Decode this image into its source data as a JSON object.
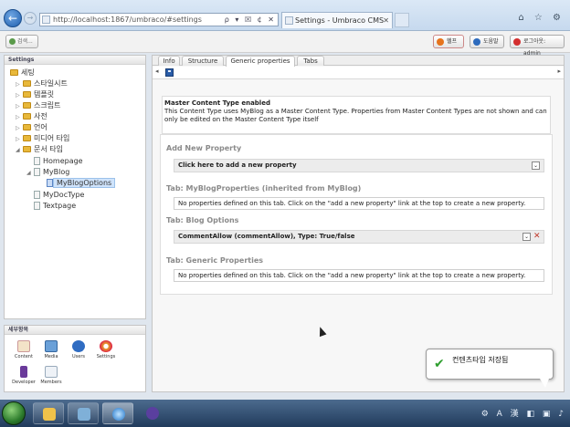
{
  "browser": {
    "url": "http://localhost:1867/umbraco/#settings",
    "address_tools": "ρ ▾ ☒ ¢ ✕",
    "tab_title": "Settings - Umbraco CMS -...",
    "tab_close": "✕",
    "window_tools": "⌂ ☆ ⚙",
    "back_glyph": "←",
    "forward_glyph": "→"
  },
  "topbar": {
    "search_label": "검색...",
    "help_label": "헬프",
    "manual_label": "도움말",
    "logout_label": "로그아웃: admin"
  },
  "left_panel": {
    "title": "Settings",
    "tree": {
      "root": "세팅",
      "stylesheets": "스타일시트",
      "templates": "템플릿",
      "scripts": "스크립트",
      "dictionary": "사전",
      "languages": "언어",
      "media_types": "미디어 타입",
      "document_types": "문서 타입",
      "homepage": "Homepage",
      "myblog": "MyBlog",
      "myblogoptions": "MyBlogOptions",
      "mydoctype": "MyDocType",
      "textpage": "Textpage"
    },
    "expand_glyph": "▷",
    "collapse_glyph": "◢"
  },
  "sections": {
    "title": "세부항목",
    "content": "Content",
    "media": "Media",
    "users": "Users",
    "settings": "Settings",
    "developer": "Developer",
    "members": "Members"
  },
  "main": {
    "tabs": {
      "info": "Info",
      "structure": "Structure",
      "generic_properties": "Generic properties",
      "tabs": "Tabs"
    },
    "scroll_left": "◂",
    "scroll_right": "▸",
    "master_title": "Master Content Type enabled",
    "master_text": "This Content Type uses MyBlog as a Master Content Type. Properties from Master Content Types are not shown and can only be edited on the Master Content Type itself",
    "add_new_property": "Add New Property",
    "add_dropdown": "Click here to add a new property",
    "tab_inherited": "Tab: MyBlogProperties (inherited from MyBlog)",
    "no_props_msg": "No properties defined on this tab. Click on the \"add a new property\" link at the top to create a new property.",
    "tab_blog_options": "Tab: Blog Options",
    "comment_allow": "CommentAllow (commentAllow), Type: True/false",
    "tab_generic": "Tab: Generic Properties",
    "no_props_msg2": "No properties defined on this tab. Click on the \"add a new property\" link at the top to create a new property.",
    "dropdown_glyph": "⌄",
    "delete_glyph": "✕"
  },
  "toast": {
    "message": "컨텐츠타입 저장됨",
    "check_glyph": "✔"
  },
  "taskbar": {
    "tray": "⚙ A 漢 ◧ ▣ ♪"
  },
  "colors": {
    "accent": "#2a5da8",
    "folder": "#e8b83a",
    "success": "#2f9e2f",
    "delete": "#c0392b"
  }
}
